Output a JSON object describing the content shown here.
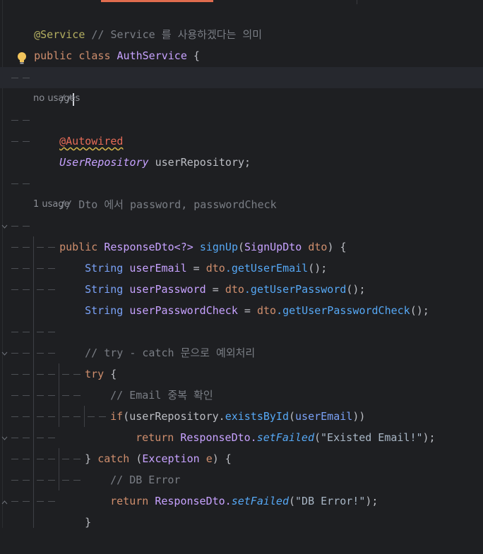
{
  "editor": {
    "language": "Java",
    "colors": {
      "background": "#1e1f22",
      "keyword": "#cf8e6d",
      "annotation": "#b3ae60",
      "string": "#6aab73",
      "comment": "#7a7e85",
      "method": "#56a8f5",
      "type_italic": "#c7a2ff",
      "current_line": "#26282e",
      "tab_indicator": "#e06c4e"
    },
    "icons": {
      "intention": "lightbulb-icon",
      "fold": "fold-marker-icon"
    },
    "lines": {
      "l1_annotation": "@Service",
      "l1_comment": "// Service 를 사용하겠다는 의미",
      "l2_public": "public",
      "l2_class": "class",
      "l2_name": "AuthService",
      "l2_brace": " {",
      "l4_comment": "//",
      "hint_no_usages": "no usages",
      "l5_autowired": "@Autowired",
      "l6_type": "UserRepository",
      "l6_field": " userRepository;",
      "l8_comment": "// Dto 에서 password, passwordCheck",
      "hint_usage": "1 usage",
      "l9_public": "public",
      "l9_type": "ResponseDto<?>",
      "l9_method": "signUp",
      "l9_open": "(",
      "l9_ptype": "SignUpDto",
      "l9_param": "dto",
      "l9_close": ") {",
      "l10_type": "String",
      "l10_var": "userEmail",
      "l10_eq": " = ",
      "l10_obj": "dto",
      "l10_call": ".getUserEmail",
      "l10_end": "();",
      "l11_type": "String",
      "l11_var": "userPassword",
      "l11_eq": " = ",
      "l11_obj": "dto",
      "l11_call": ".getUserPassword",
      "l11_end": "();",
      "l12_type": "String",
      "l12_var": "userPasswordCheck",
      "l12_eq": " = ",
      "l12_obj": "dto",
      "l12_call": ".getUserPasswordCheck",
      "l12_end": "();",
      "l14_comment": "// try - catch 문으로 예외처리",
      "l15_try": "try",
      "l15_brace": " {",
      "l16_comment": "// Email 중복 확인",
      "l17_if": "if",
      "l17_a": "(userRepository.",
      "l17_call": "existsById",
      "l17_b": "(",
      "l17_arg": "userEmail",
      "l17_c": "))",
      "l18_return": "return",
      "l18_cls": " ResponseDto.",
      "l18_call": "setFailed",
      "l18_a": "(",
      "l18_str": "\"Existed Email!\"",
      "l18_b": ");",
      "l19_close": "} ",
      "l19_catch": "catch",
      "l19_a": " (",
      "l19_ex": "Exception",
      "l19_e": " e",
      "l19_b": ") {",
      "l20_comment": "// DB Error",
      "l21_return": "return",
      "l21_cls": " ResponseDto.",
      "l21_call": "setFailed",
      "l21_a": "(",
      "l21_str": "\"DB Error!\"",
      "l21_b": ");",
      "l22_close": "}"
    }
  }
}
